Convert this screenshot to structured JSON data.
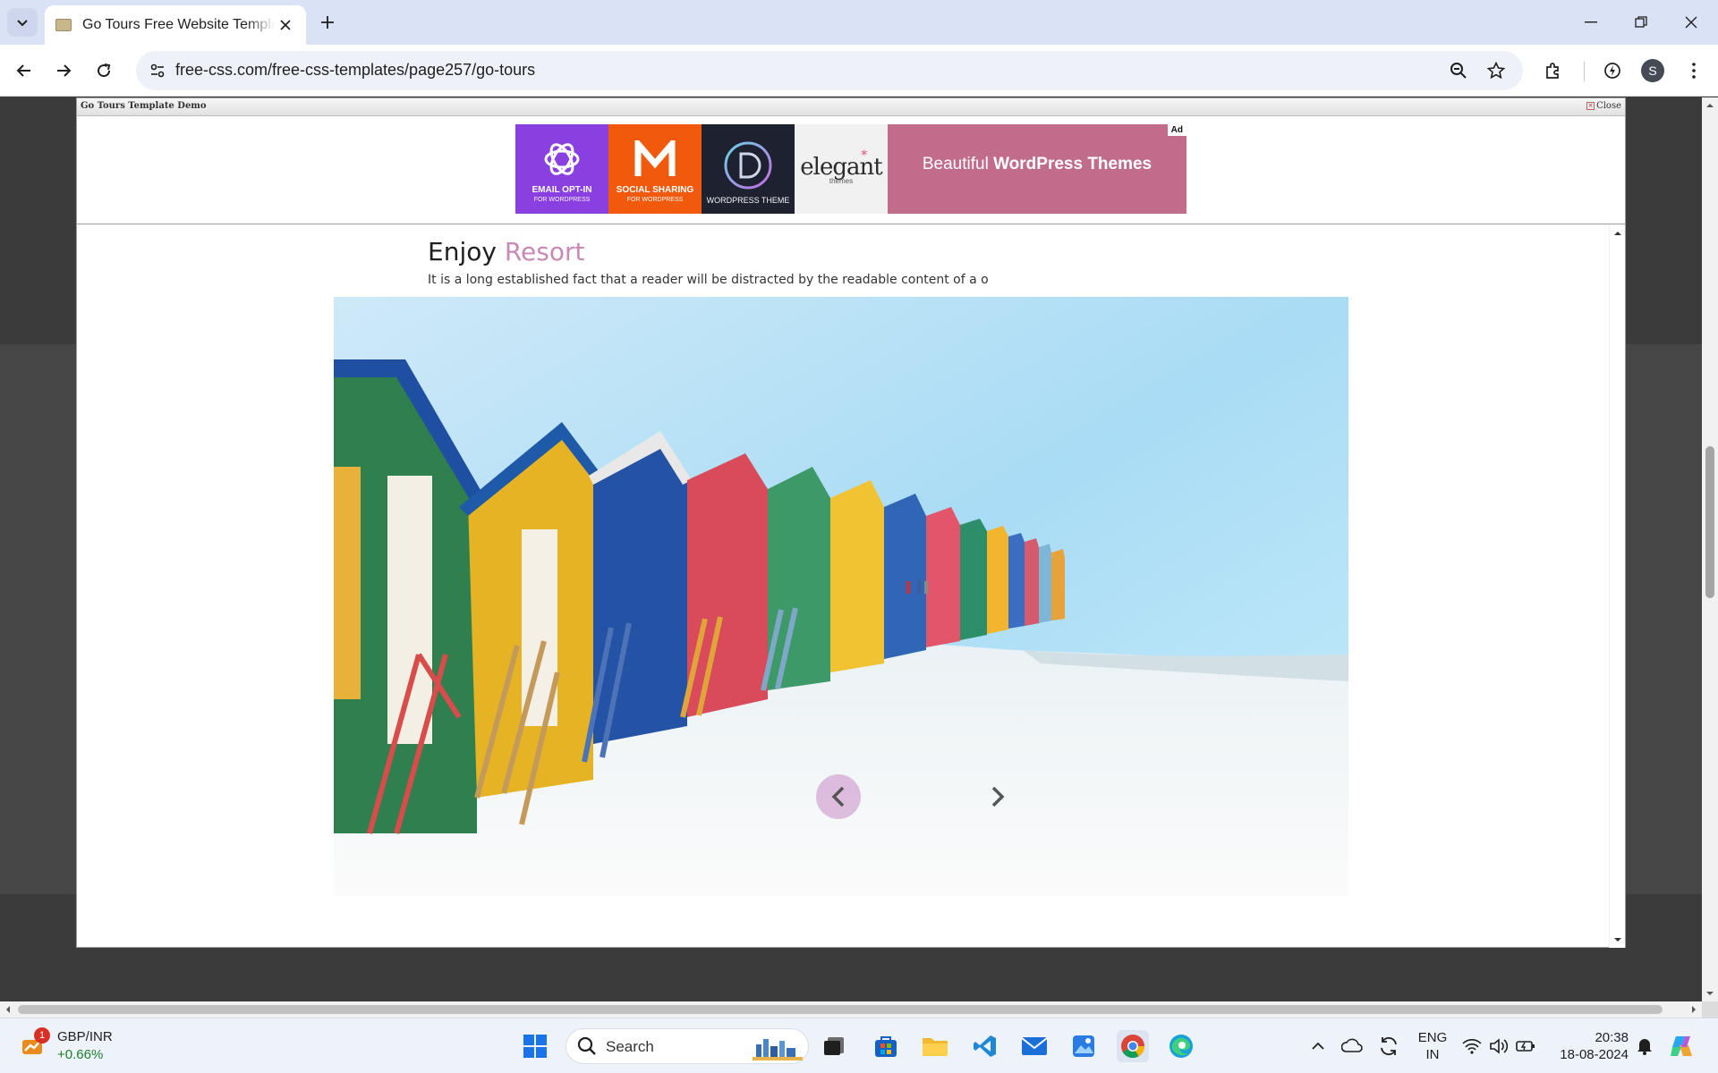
{
  "browser": {
    "tab_title": "Go Tours Free Website Template",
    "url": "free-css.com/free-css-templates/page257/go-tours",
    "profile_initial": "S"
  },
  "demo_bar": {
    "title": "Go Tours Template Demo",
    "close_label": "Close"
  },
  "ad": {
    "badge": "Ad",
    "tile1_line1": "EMAIL OPT-IN",
    "tile1_line2": "FOR WORDPRESS",
    "tile2_line1": "SOCIAL SHARING",
    "tile2_line2": "FOR WORDPRESS",
    "tile3_line1": "WORDPRESS THEME",
    "tile4_brand": "elegant",
    "tile4_sub": "themes",
    "banner_prefix": "Beautiful ",
    "banner_bold": "WordPress Themes"
  },
  "content": {
    "heading_word1": "Enjoy",
    "heading_word2": "Resort",
    "lead_text": "It is a long established fact that a reader will be distracted by the readable content of a o"
  },
  "taskbar": {
    "ticker_badge": "1",
    "ticker_name": "GBP/INR",
    "ticker_change": "+0.66%",
    "search_label": "Search",
    "lang_line1": "ENG",
    "lang_line2": "IN",
    "time": "20:38",
    "date": "18-08-2024"
  },
  "colors": {
    "accent_resort": "#c88ab4",
    "tabstrip_bg": "#dae2f5",
    "ticker_positive": "#1b7e2d"
  },
  "icons": [
    "tab-search-icon",
    "close-icon",
    "plus-icon",
    "minimize-icon",
    "restore-icon",
    "back-icon",
    "forward-icon",
    "reload-icon",
    "site-info-icon",
    "zoom-icon",
    "star-icon",
    "extensions-icon",
    "performance-icon",
    "menu-icon",
    "chevron-left-icon",
    "chevron-right-icon",
    "windows-start-icon",
    "search-icon",
    "wifi-icon",
    "volume-icon",
    "battery-icon",
    "bell-icon"
  ]
}
